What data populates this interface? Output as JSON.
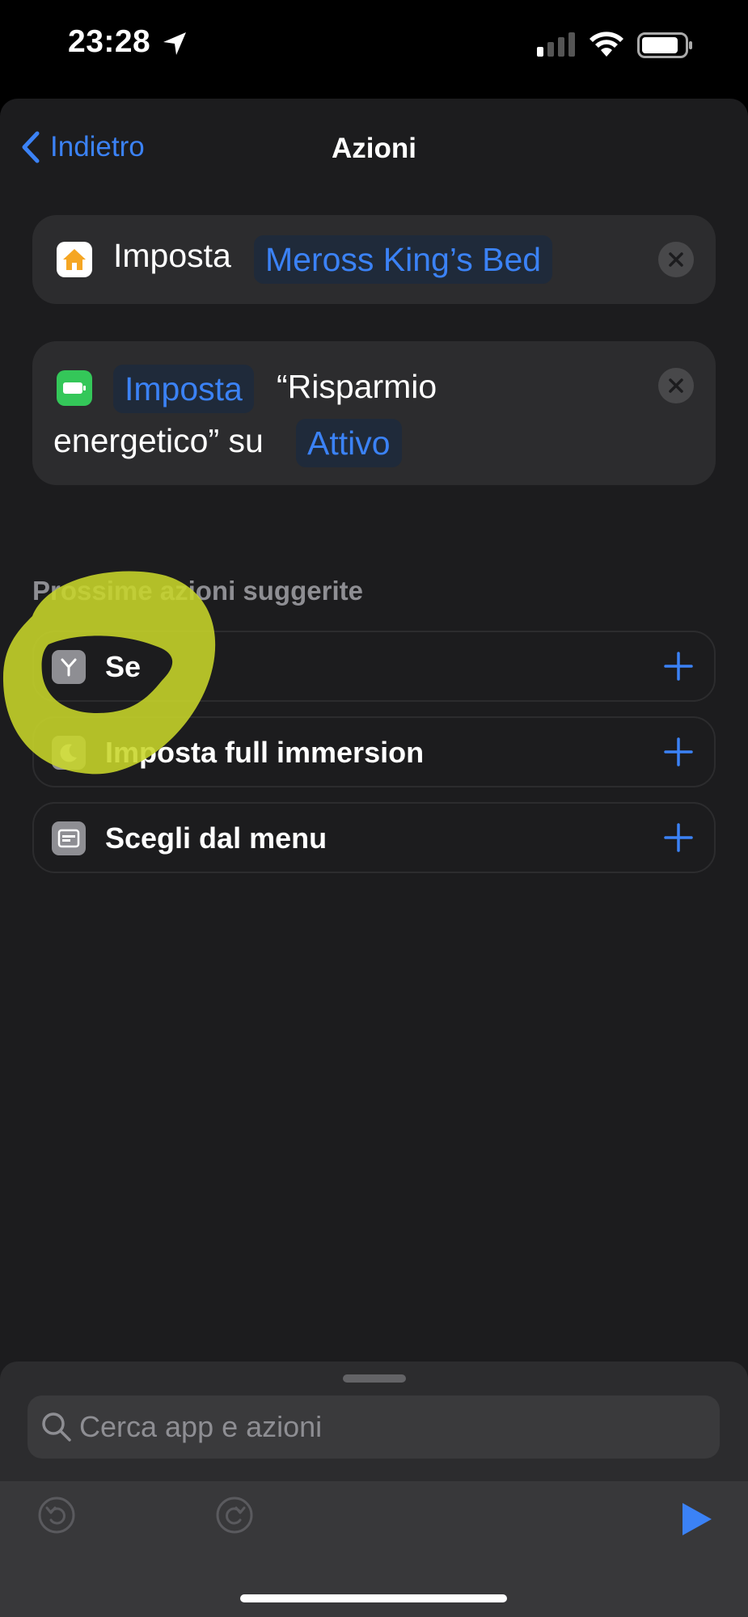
{
  "status_bar": {
    "time": "23:28"
  },
  "nav": {
    "back_label": "Indietro",
    "title": "Azioni"
  },
  "action1": {
    "verb": "Imposta",
    "device": "Meross King’s Bed"
  },
  "action2": {
    "verb": "Imposta",
    "text_part1": "“Risparmio",
    "text_part2": "energetico” su",
    "state": "Attivo"
  },
  "suggestions": {
    "title": "Prossime azioni suggerite",
    "items": [
      {
        "label": "Se",
        "icon": "branch-icon"
      },
      {
        "label": "Imposta full immersion",
        "icon": "moon-icon"
      },
      {
        "label": "Scegli dal menu",
        "icon": "menu-icon"
      }
    ]
  },
  "search": {
    "placeholder": "Cerca app e azioni"
  },
  "colors": {
    "accent": "#3b82f6",
    "background": "#1c1c1e",
    "card": "#2c2c2e",
    "highlight": "#c8d62a"
  }
}
